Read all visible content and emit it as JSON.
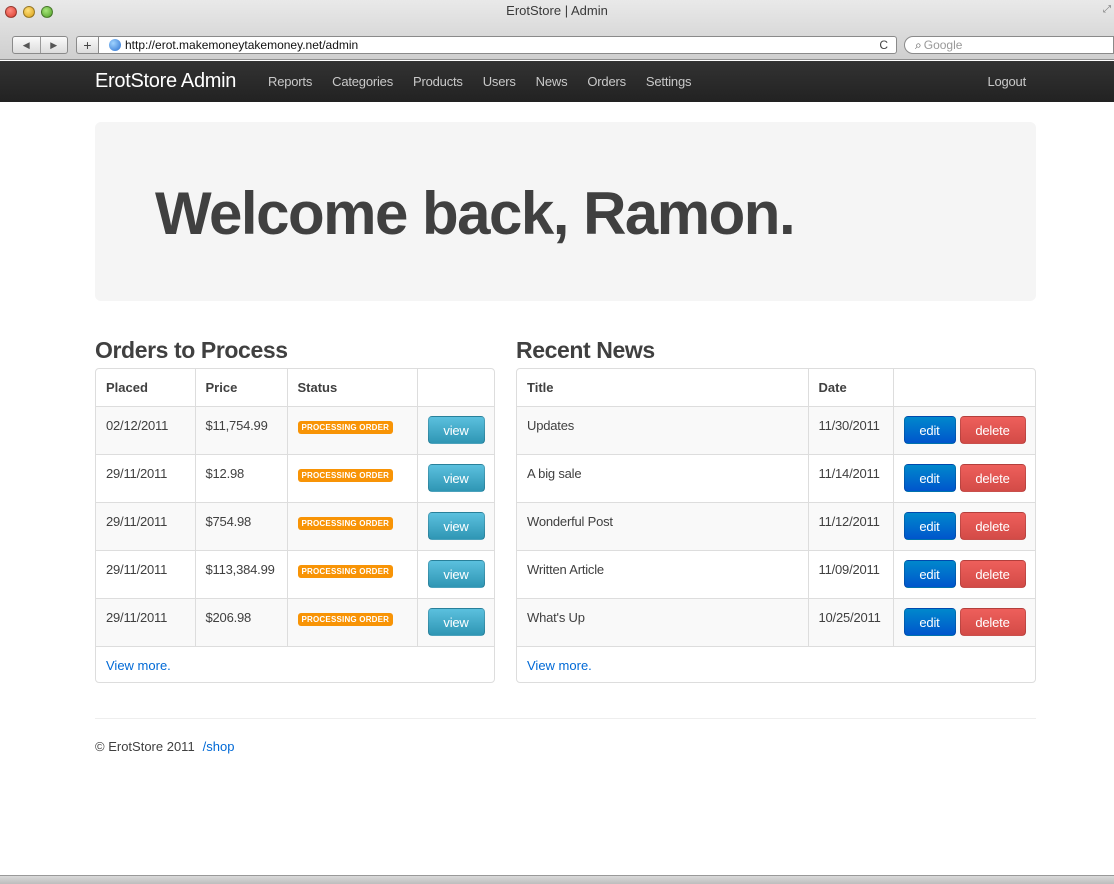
{
  "window": {
    "title": "ErotStore | Admin",
    "url": "http://erot.makemoneytakemoney.net/admin",
    "search_placeholder": "Google",
    "back_label": "◀",
    "forward_label": "▶",
    "add_label": "+",
    "reload_label": "C"
  },
  "navbar": {
    "brand": "ErotStore Admin",
    "links": [
      "Reports",
      "Categories",
      "Products",
      "Users",
      "News",
      "Orders",
      "Settings"
    ],
    "logout": "Logout"
  },
  "hero": {
    "heading": "Welcome back, Ramon."
  },
  "orders": {
    "title": "Orders to Process",
    "columns": [
      "Placed",
      "Price",
      "Status",
      ""
    ],
    "rows": [
      {
        "placed": "02/12/2011",
        "price": "$11,754.99",
        "status": "PROCESSING ORDER",
        "action": "view"
      },
      {
        "placed": "29/11/2011",
        "price": "$12.98",
        "status": "PROCESSING ORDER",
        "action": "view"
      },
      {
        "placed": "29/11/2011",
        "price": "$754.98",
        "status": "PROCESSING ORDER",
        "action": "view"
      },
      {
        "placed": "29/11/2011",
        "price": "$113,384.99",
        "status": "PROCESSING ORDER",
        "action": "view"
      },
      {
        "placed": "29/11/2011",
        "price": "$206.98",
        "status": "PROCESSING ORDER",
        "action": "view"
      }
    ],
    "view_more": "View more."
  },
  "news": {
    "title": "Recent News",
    "columns": [
      "Title",
      "Date",
      ""
    ],
    "rows": [
      {
        "title": "Updates",
        "date": "11/30/2011",
        "edit": "edit",
        "delete": "delete"
      },
      {
        "title": "A big sale",
        "date": "11/14/2011",
        "edit": "edit",
        "delete": "delete"
      },
      {
        "title": "Wonderful Post",
        "date": "11/12/2011",
        "edit": "edit",
        "delete": "delete"
      },
      {
        "title": "Written Article",
        "date": "11/09/2011",
        "edit": "edit",
        "delete": "delete"
      },
      {
        "title": "What's Up",
        "date": "10/25/2011",
        "edit": "edit",
        "delete": "delete"
      }
    ],
    "view_more": "View more."
  },
  "footer": {
    "copyright": "© ErotStore 2011",
    "shop_link": "/shop"
  },
  "colors": {
    "navbar": "#222222",
    "badge": "#f89406",
    "info": "#2f96b4",
    "primary": "#0088cc",
    "danger": "#ee5f5b",
    "link": "#0069d6"
  }
}
